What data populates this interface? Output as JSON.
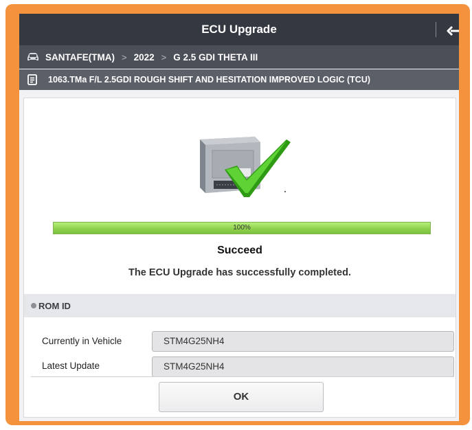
{
  "header": {
    "title": "ECU Upgrade",
    "back_icon": "back-arrow-icon"
  },
  "breadcrumb": {
    "icon": "car-icon",
    "items": [
      "SANTAFE(TMA)",
      "2022",
      "G 2.5 GDI THETA III"
    ]
  },
  "upgrade_item": {
    "icon": "document-icon",
    "text": "1063.TMa F/L 2.5GDI ROUGH SHIFT AND HESITATION IMPROVED LOGIC (TCU)"
  },
  "status": {
    "graphic": "ecu-checkmark-icon",
    "progress_fraction": 1.0,
    "progress_text": "100%",
    "title": "Succeed",
    "message": "The ECU Upgrade has successfully completed."
  },
  "rom": {
    "header": "ROM ID",
    "rows": [
      {
        "label": "Currently in Vehicle",
        "value": "STM4G25NH4"
      },
      {
        "label": "Latest Update",
        "value": "STM4G25NH4"
      }
    ]
  },
  "actions": {
    "ok_label": "OK"
  },
  "colors": {
    "frame": "#f5923e",
    "titlebar": "#343841",
    "progress_fill": "#8fd24e",
    "checkmark": "#3fb21c"
  }
}
